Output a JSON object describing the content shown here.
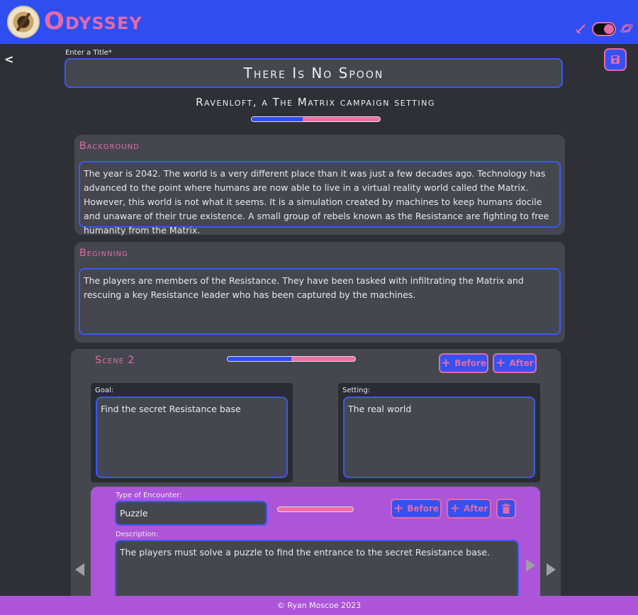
{
  "header": {
    "brand": "Odyssey",
    "theme_toggle_on": true
  },
  "nav": {
    "back_label": "<"
  },
  "title": {
    "label": "Enter a Title*",
    "value": "There Is No Spoon"
  },
  "subtitle": "Ravenloft, a The Matrix campaign setting",
  "progress": {
    "fraction": 0.4
  },
  "background": {
    "heading": "Background",
    "text": "The year is 2042. The world is a very different place than it was just a few decades ago. Technology has advanced to the point where humans are now able to live in a virtual reality world called the Matrix. However, this world is not what it seems. It is a simulation created by machines to keep humans docile and unaware of their true existence. A small group of rebels known as the Resistance are fighting to free humanity from the Matrix."
  },
  "beginning": {
    "heading": "Beginning",
    "text": "The players are members of the Resistance. They have been tasked with infiltrating the Matrix and rescuing a key Resistance leader who has been captured by the machines."
  },
  "scene": {
    "title": "Scene 2",
    "progress_fraction": 0.5,
    "before_label": "Before",
    "after_label": "After",
    "goal_label": "Goal:",
    "goal_value": "Find the secret Resistance base",
    "setting_label": "Setting:",
    "setting_value": "The real world"
  },
  "encounter": {
    "type_label": "Type of Encounter:",
    "type_value": "Puzzle",
    "progress_fraction": 0.0,
    "before_label": "Before",
    "after_label": "After",
    "description_label": "Description:",
    "description_value": "The players must solve a puzzle to find the entrance to the secret Resistance base."
  },
  "footer": {
    "text": "© Ryan Moscoe 2023"
  },
  "colors": {
    "primary_blue": "#2f4ef2",
    "accent_pink": "#e36aa8",
    "encounter_purple": "#ad55d8",
    "panel_gray": "#44484e",
    "page_bg": "#2f3036"
  }
}
